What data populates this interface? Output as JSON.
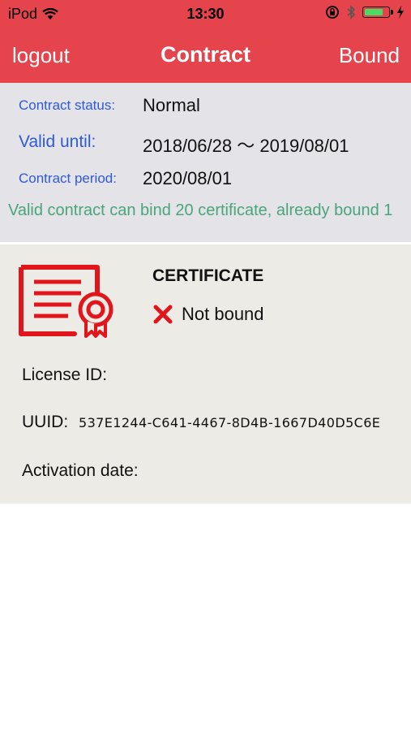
{
  "status_bar": {
    "carrier": "iPod",
    "time": "13:30",
    "battery_level": 0.8
  },
  "nav": {
    "left_label": "logout",
    "title": "Contract",
    "right_label": "Bound"
  },
  "contract": {
    "status_label": "Contract status:",
    "status_value": "Normal",
    "valid_label": "Valid until:",
    "valid_value": "2018/06/28 ～ 2019/08/01",
    "period_label": "Contract period:",
    "period_value": "2020/08/01",
    "notice": "Valid contract can bind 20 certificate, already bound 1"
  },
  "certificate": {
    "title": "CERTIFICATE",
    "bound_status": "Not bound",
    "license_label": "License ID:",
    "license_value": "",
    "uuid_label": "UUID:",
    "uuid_value": "537E1244-C641-4467-8D4B-1667D40D5C6E",
    "activation_label": "Activation date:",
    "activation_value": ""
  },
  "colors": {
    "accent": "#e5444c",
    "label_blue": "#2f5ad8",
    "notice_green": "#4aa57a",
    "icon_red": "#e3151c"
  }
}
